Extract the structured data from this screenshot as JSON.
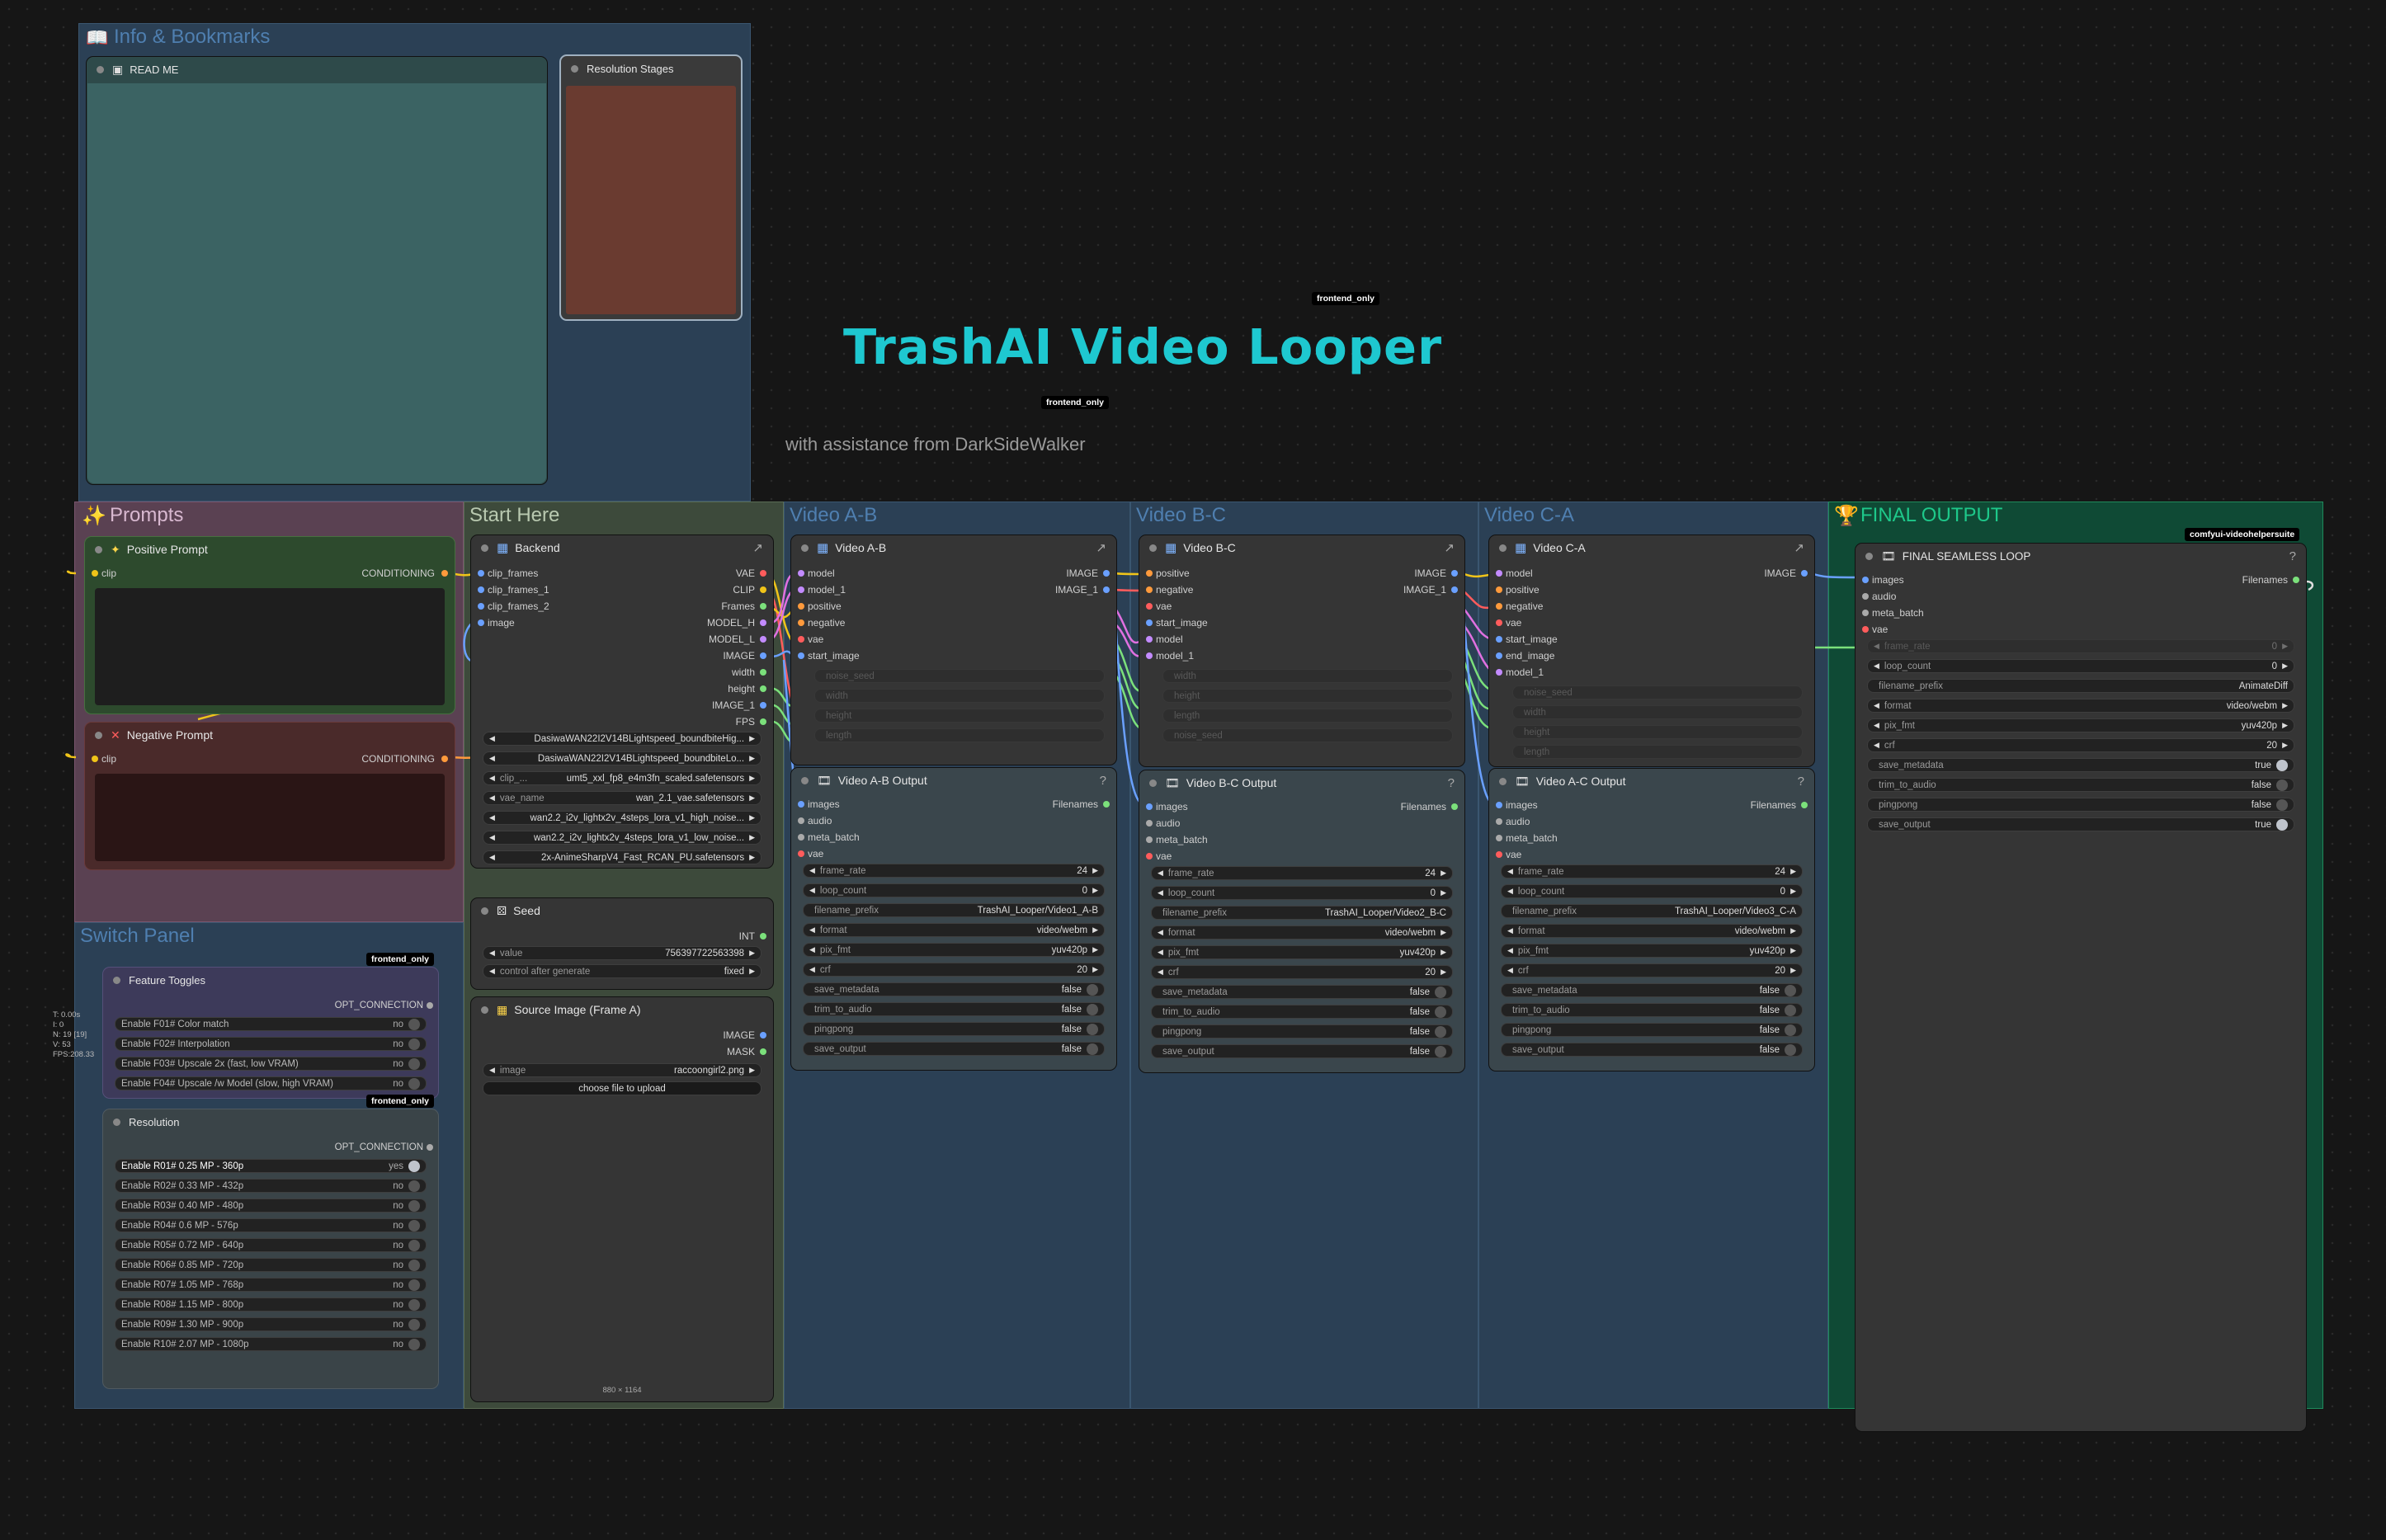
{
  "canvas_text": {
    "title": "TrashAI Video Looper",
    "subtitle": "with assistance from DarkSideWalker",
    "tag_top": "frontend_only",
    "tag_mid": "frontend_only",
    "tag_switch": "frontend_only",
    "tag_switch2": "frontend_only",
    "tag_final": "comfyui-videohelpersuite",
    "stats": [
      "T: 0.00s",
      "I: 0",
      "N: 19 [19]",
      "V: 53",
      "FPS:208.33"
    ]
  },
  "groups": {
    "info": "Info & Bookmarks",
    "prompts": "Prompts",
    "start": "Start Here",
    "vab": "Video A-B",
    "vbc": "Video B-C",
    "vca": "Video C-A",
    "final": "FINAL OUTPUT",
    "switch": "Switch Panel"
  },
  "readme": {
    "title": "READ ME"
  },
  "resstages": {
    "title": "Resolution Stages"
  },
  "positive": {
    "title": "Positive Prompt",
    "in": "clip",
    "out": "CONDITIONING"
  },
  "negative": {
    "title": "Negative Prompt",
    "in": "clip",
    "out": "CONDITIONING"
  },
  "backend": {
    "title": "Backend",
    "inputs": [
      "clip_frames",
      "clip_frames_1",
      "clip_frames_2",
      "image"
    ],
    "outputs": [
      "VAE",
      "CLIP",
      "Frames",
      "MODEL_H",
      "MODEL_L",
      "IMAGE",
      "width",
      "height",
      "IMAGE_1",
      "FPS"
    ],
    "widgets": [
      {
        "label": "",
        "value": "DasiwaWAN22I2V14BLightspeed_boundbiteHig..."
      },
      {
        "label": "",
        "value": "DasiwaWAN22I2V14BLightspeed_boundbiteLo..."
      },
      {
        "label": "clip_...",
        "value": "umt5_xxl_fp8_e4m3fn_scaled.safetensors"
      },
      {
        "label": "vae_name",
        "value": "wan_2.1_vae.safetensors"
      },
      {
        "label": "",
        "value": "wan2.2_i2v_lightx2v_4steps_lora_v1_high_noise..."
      },
      {
        "label": "",
        "value": "wan2.2_i2v_lightx2v_4steps_lora_v1_low_noise..."
      },
      {
        "label": "",
        "value": "2x-AnimeSharpV4_Fast_RCAN_PU.safetensors"
      }
    ]
  },
  "seed": {
    "title": "Seed",
    "out": "INT",
    "value_label": "value",
    "value": "756397722563398",
    "cag_label": "control after generate",
    "cag": "fixed"
  },
  "source": {
    "title": "Source Image (Frame A)",
    "out1": "IMAGE",
    "out2": "MASK",
    "img_label": "image",
    "img_value": "raccoongirl2.png",
    "upload": "choose file to upload",
    "dims": "880 × 1164"
  },
  "vab_node": {
    "title": "Video A-B",
    "inputs": [
      "model",
      "model_1",
      "positive",
      "negative",
      "vae",
      "start_image"
    ],
    "outputs": [
      "IMAGE",
      "IMAGE_1"
    ],
    "widgets": [
      "noise_seed",
      "width",
      "height",
      "length"
    ]
  },
  "vbc_node": {
    "title": "Video B-C",
    "inputs": [
      "positive",
      "negative",
      "vae",
      "start_image",
      "model",
      "model_1"
    ],
    "outputs": [
      "IMAGE",
      "IMAGE_1"
    ],
    "widgets": [
      "width",
      "height",
      "length",
      "noise_seed"
    ]
  },
  "vca_node": {
    "title": "Video C-A",
    "inputs": [
      "model",
      "positive",
      "negative",
      "vae",
      "start_image",
      "end_image",
      "model_1"
    ],
    "outputs": [
      "IMAGE"
    ],
    "widgets": [
      "noise_seed",
      "width",
      "height",
      "length"
    ]
  },
  "out_ab": {
    "title": "Video A-B Output",
    "prefix": "TrashAI_Looper/Video1_A-B"
  },
  "out_bc": {
    "title": "Video B-C Output",
    "prefix": "TrashAI_Looper/Video2_B-C"
  },
  "out_ca": {
    "title": "Video A-C Output",
    "prefix": "TrashAI_Looper/Video3_C-A"
  },
  "combine_common": {
    "inputs": [
      "images",
      "audio",
      "meta_batch",
      "vae"
    ],
    "output": "Filenames",
    "frame_rate_label": "frame_rate",
    "frame_rate": "24",
    "loop_count_label": "loop_count",
    "loop_count": "0",
    "prefix_label": "filename_prefix",
    "format_label": "format",
    "format": "video/webm",
    "pix_fmt_label": "pix_fmt",
    "pix_fmt": "yuv420p",
    "crf_label": "crf",
    "crf": "20",
    "save_metadata_label": "save_metadata",
    "save_metadata": "false",
    "trim_label": "trim_to_audio",
    "trim": "false",
    "pingpong_label": "pingpong",
    "pingpong": "false",
    "save_output_label": "save_output",
    "save_output": "false"
  },
  "final_node": {
    "title": "FINAL SEAMLESS LOOP",
    "frame_rate": "0",
    "loop_count": "0",
    "prefix": "AnimateDiff",
    "format": "video/webm",
    "pix_fmt": "yuv420p",
    "crf": "20",
    "save_metadata": "true",
    "trim": "false",
    "pingpong": "false",
    "save_output": "true"
  },
  "features": {
    "title": "Feature Toggles",
    "out": "OPT_CONNECTION",
    "items": [
      {
        "label": "Enable F01# Color match",
        "value": "no"
      },
      {
        "label": "Enable F02# Interpolation",
        "value": "no"
      },
      {
        "label": "Enable F03# Upscale 2x (fast, low VRAM)",
        "value": "no"
      },
      {
        "label": "Enable F04# Upscale /w Model (slow, high VRAM)",
        "value": "no"
      }
    ]
  },
  "resolution": {
    "title": "Resolution",
    "out": "OPT_CONNECTION",
    "items": [
      {
        "label": "Enable R01# 0.25 MP - 360p",
        "value": "yes"
      },
      {
        "label": "Enable R02# 0.33 MP - 432p",
        "value": "no"
      },
      {
        "label": "Enable R03# 0.40 MP - 480p",
        "value": "no"
      },
      {
        "label": "Enable R04# 0.6 MP - 576p",
        "value": "no"
      },
      {
        "label": "Enable R05# 0.72 MP - 640p",
        "value": "no"
      },
      {
        "label": "Enable R06# 0.85 MP - 720p",
        "value": "no"
      },
      {
        "label": "Enable R07# 1.05 MP - 768p",
        "value": "no"
      },
      {
        "label": "Enable R08# 1.15 MP - 800p",
        "value": "no"
      },
      {
        "label": "Enable R09# 1.30 MP - 900p",
        "value": "no"
      },
      {
        "label": "Enable R10# 2.07 MP - 1080p",
        "value": "no"
      }
    ]
  },
  "colors": {
    "title_cyan": "#1ec8d0",
    "group_blue": "#2f4f6a",
    "group_pink": "#6e4a63",
    "group_green": "#4a5a46",
    "group_final": "#0f6a45",
    "slot_yellow": "#f0c419",
    "slot_blue": "#6aa0ff",
    "slot_green": "#7be07b",
    "slot_red": "#ff5c5c",
    "slot_orange": "#ff9a3c"
  }
}
